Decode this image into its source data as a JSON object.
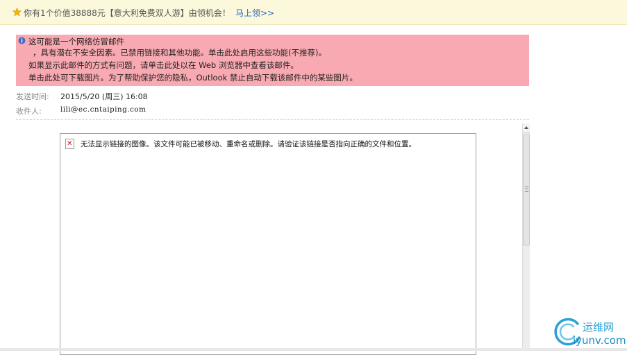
{
  "promo": {
    "text": "你有1个价值38888元【意大利免费双人游】由领机会！",
    "link": "马上领>>"
  },
  "warning": {
    "line1": "这可能是一个网络仿冒邮件",
    "line2": "，具有潜在不安全因素。已禁用链接和其他功能。单击此处启用这些功能(不推荐)。",
    "line3": "如果显示此邮件的方式有问题，请单击此处以在 Web 浏览器中查看该邮件。",
    "line4": "单击此处可下载图片。为了帮助保护您的隐私，Outlook 禁止自动下载该邮件中的某些图片。"
  },
  "header": {
    "sent_label": "发送时间:",
    "sent_value": "2015/5/20 (周三) 16:08",
    "to_label": "收件人:",
    "to_value": "lili@ec.cntaiping.com"
  },
  "body": {
    "broken_image_text": "无法显示链接的图像。该文件可能已被移动、重命名或删除。请验证该链接是否指向正确的文件和位置。"
  },
  "watermark": {
    "cn": "运维网",
    "en": "iyunv.com"
  },
  "colors": {
    "promo_bg": "#fcf8db",
    "warning_bg": "#f9a9b2",
    "link": "#2a64b8",
    "watermark": "#2aa0d6"
  }
}
